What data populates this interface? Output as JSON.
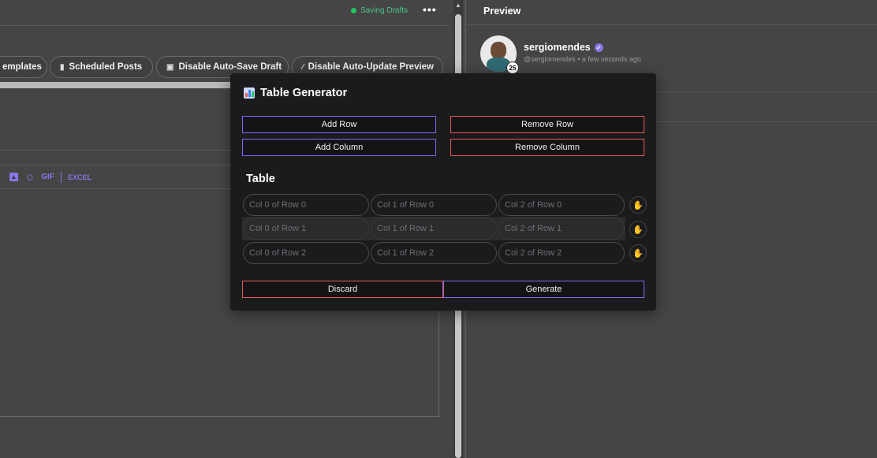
{
  "editor": {
    "status": "Saving Drafts",
    "more_icon": "•••",
    "chips": [
      {
        "label": "emplates",
        "icon": ""
      },
      {
        "label": "Scheduled Posts",
        "icon": "file-icon"
      },
      {
        "label": "Disable Auto-Save Draft",
        "icon": "save-icon"
      },
      {
        "label": "Disable Auto-Update Preview",
        "icon": "wand-icon"
      }
    ],
    "toolbar": {
      "gif": "GIF",
      "excel": "EXCEL"
    }
  },
  "preview": {
    "title": "Preview",
    "username": "sergiomendes",
    "handle": "@sergiomendes",
    "time": "a few seconds ago",
    "badge_count": "25"
  },
  "modal": {
    "title": "Table Generator",
    "add_row": "Add Row",
    "remove_row": "Remove Row",
    "add_column": "Add Column",
    "remove_column": "Remove Column",
    "table_title": "Table",
    "rows": [
      [
        "Col 0 of Row 0",
        "Col 1 of Row 0",
        "Col 2 of Row 0"
      ],
      [
        "Col 0 of Row 1",
        "Col 1 of Row 1",
        "Col 2 of Row 1"
      ],
      [
        "Col 0 of Row 2",
        "Col 1 of Row 2",
        "Col 2 of Row 2"
      ]
    ],
    "discard": "Discard",
    "generate": "Generate"
  },
  "colors": {
    "accent": "#7b6ef6",
    "danger": "#e45b5b",
    "success": "#22c55e"
  }
}
